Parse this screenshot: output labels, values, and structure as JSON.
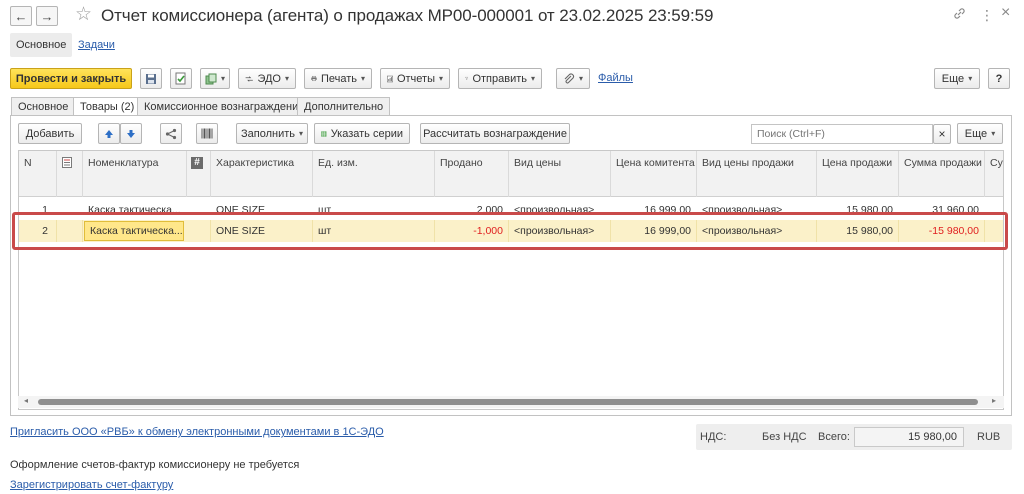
{
  "window": {
    "title": "Отчет комиссионера (агента) о продажах МР00-000001 от 23.02.2025 23:59:59",
    "back_arrow": "←",
    "forward_arrow": "→",
    "star_glyph": "☆",
    "link_glyph": "🔗",
    "more_glyph": "⋮",
    "close_glyph": "×"
  },
  "sections": {
    "main": "Основное",
    "tasks": "Задачи"
  },
  "toolbar": {
    "post_close": "Провести и закрыть",
    "save_glyph": "🖫",
    "edo": "ЭДО",
    "print": "Печать",
    "reports": "Отчеты",
    "send": "Отправить",
    "files": "Файлы",
    "more": "Еще",
    "help": "?"
  },
  "doc_tabs": [
    "Основное",
    "Товары (2)",
    "Комиссионное вознаграждение",
    "Дополнительно"
  ],
  "table_toolbar": {
    "add": "Добавить",
    "up_glyph": "🡅",
    "down_glyph": "🡇",
    "fill": "Заполнить",
    "series": "Указать серии",
    "calc": "Рассчитать вознаграждение",
    "search_placeholder": "Поиск (Ctrl+F)",
    "clear_glyph": "×",
    "more": "Еще"
  },
  "table": {
    "columns": [
      "N",
      "",
      "Номенклатура",
      "",
      "Характеристика",
      "Ед. изм.",
      "Продано",
      "Вид цены",
      "Цена комитента",
      "Вид цены продажи",
      "Цена продажи",
      "Сумма продажи",
      "Су"
    ],
    "rows": [
      {
        "n": "1",
        "item": "Каска тактическа...",
        "characteristic": "ONE SIZE",
        "unit": "шт",
        "sold": "2,000",
        "price_type": "<произвольная>",
        "committent_price": "16 999,00",
        "sale_price_type": "<произвольная>",
        "sale_price": "15 980,00",
        "sale_amount": "31 960,00"
      },
      {
        "n": "2",
        "item": "Каска тактическа...",
        "characteristic": "ONE SIZE",
        "unit": "шт",
        "sold": "-1,000",
        "price_type": "<произвольная>",
        "committent_price": "16 999,00",
        "sale_price_type": "<произвольная>",
        "sale_price": "15 980,00",
        "sale_amount": "-15 980,00"
      }
    ]
  },
  "bottom": {
    "invite_link": "Пригласить ООО «РВБ» к обмену электронными документами в 1С-ЭДО",
    "vat_label": "НДС:",
    "vat_value": "Без НДС",
    "total_label": "Всего:",
    "total_value": "15 980,00",
    "currency": "RUB",
    "invoice_note": "Оформление счетов-фактур комиссионеру не требуется",
    "register_link": "Зарегистрировать счет-фактуру"
  },
  "colors": {
    "accent_yellow": "#f6c81a",
    "link_blue": "#2a5caa",
    "negative_red": "#e02020",
    "selected_row": "#fbf1c9",
    "highlight_border": "#c94a4a"
  }
}
